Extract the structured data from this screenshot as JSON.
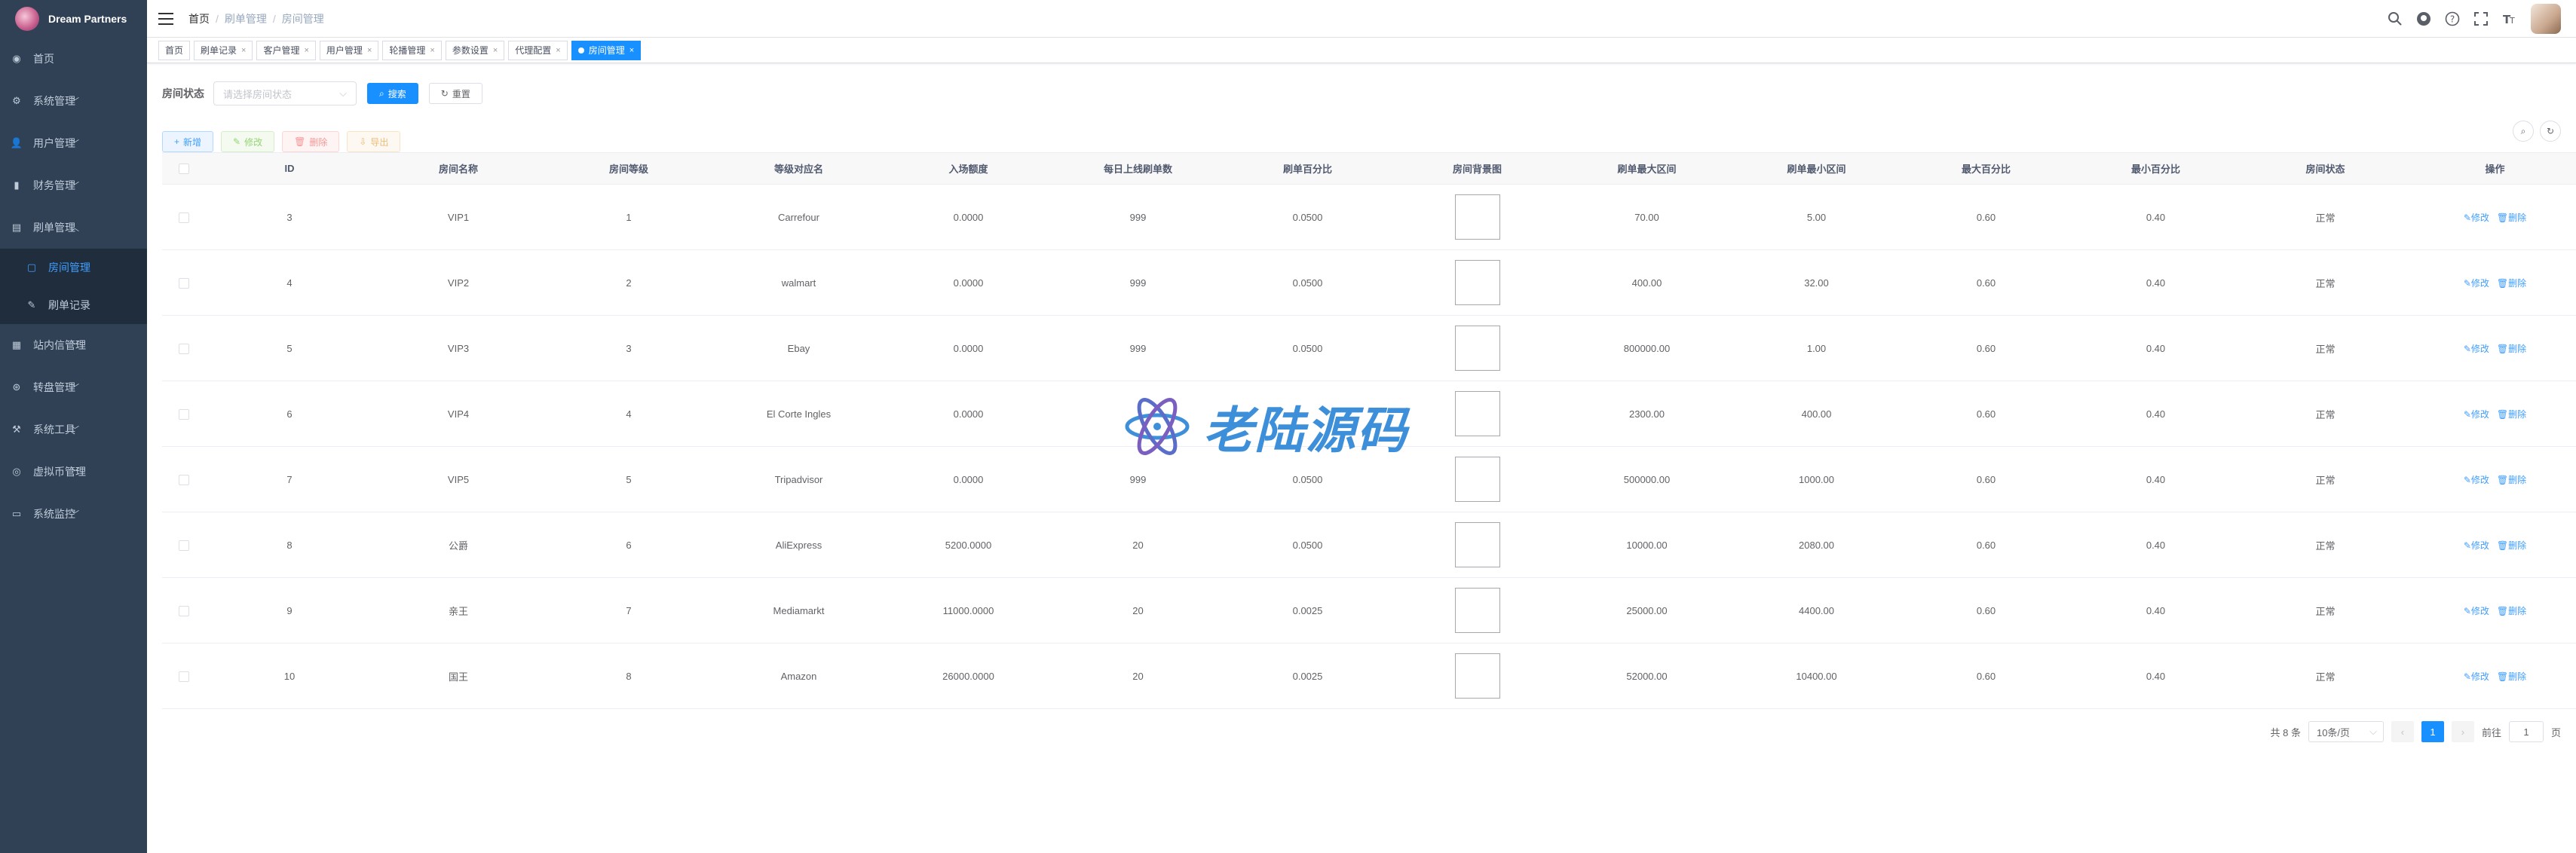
{
  "app": {
    "name": "Dream Partners"
  },
  "sidebar": {
    "items": [
      {
        "label": "首页",
        "icon": "dashboard-icon"
      },
      {
        "label": "系统管理",
        "icon": "gear-icon"
      },
      {
        "label": "用户管理",
        "icon": "users-icon"
      },
      {
        "label": "财务管理",
        "icon": "bar-chart-icon"
      },
      {
        "label": "刷单管理",
        "icon": "document-icon"
      },
      {
        "label": "站内信管理",
        "icon": "folder-icon"
      },
      {
        "label": "转盘管理",
        "icon": "wheel-icon"
      },
      {
        "label": "系统工具",
        "icon": "tool-icon"
      },
      {
        "label": "虚拟币管理",
        "icon": "coin-icon"
      },
      {
        "label": "系统监控",
        "icon": "monitor-icon"
      }
    ],
    "submenu": [
      {
        "label": "房间管理",
        "icon": "window-icon"
      },
      {
        "label": "刷单记录",
        "icon": "edit-icon"
      }
    ]
  },
  "breadcrumb": {
    "home": "首页",
    "parent": "刷单管理",
    "current": "房间管理"
  },
  "tags": {
    "items": [
      "首页",
      "刷单记录",
      "客户管理",
      "用户管理",
      "轮播管理",
      "参数设置",
      "代理配置",
      "房间管理"
    ]
  },
  "search": {
    "label": "房间状态",
    "placeholder": "请选择房间状态",
    "search_btn": "搜索",
    "reset_btn": "重置"
  },
  "toolbar": {
    "add": "新增",
    "edit": "修改",
    "delete": "删除",
    "export": "导出"
  },
  "table": {
    "headers": [
      "ID",
      "房间名称",
      "房间等级",
      "等级对应名",
      "入场额度",
      "每日上线刷单数",
      "刷单百分比",
      "房间背景图",
      "刷单最大区间",
      "刷单最小区间",
      "最大百分比",
      "最小百分比",
      "房间状态",
      "操作"
    ],
    "op_edit": "修改",
    "op_delete": "删除",
    "rows": [
      {
        "id": "3",
        "name": "VIP1",
        "level": "1",
        "level_name": "Carrefour",
        "entry": "0.0000",
        "daily": "999",
        "percent": "0.0500",
        "max_range": "70.00",
        "min_range": "5.00",
        "max_pct": "0.60",
        "min_pct": "0.40",
        "status": "正常"
      },
      {
        "id": "4",
        "name": "VIP2",
        "level": "2",
        "level_name": "walmart",
        "entry": "0.0000",
        "daily": "999",
        "percent": "0.0500",
        "max_range": "400.00",
        "min_range": "32.00",
        "max_pct": "0.60",
        "min_pct": "0.40",
        "status": "正常"
      },
      {
        "id": "5",
        "name": "VIP3",
        "level": "3",
        "level_name": "Ebay",
        "entry": "0.0000",
        "daily": "999",
        "percent": "0.0500",
        "max_range": "800000.00",
        "min_range": "1.00",
        "max_pct": "0.60",
        "min_pct": "0.40",
        "status": "正常"
      },
      {
        "id": "6",
        "name": "VIP4",
        "level": "4",
        "level_name": "El Corte Ingles",
        "entry": "0.0000",
        "daily": "",
        "percent": "",
        "max_range": "2300.00",
        "min_range": "400.00",
        "max_pct": "0.60",
        "min_pct": "0.40",
        "status": "正常"
      },
      {
        "id": "7",
        "name": "VIP5",
        "level": "5",
        "level_name": "Tripadvisor",
        "entry": "0.0000",
        "daily": "999",
        "percent": "0.0500",
        "max_range": "500000.00",
        "min_range": "1000.00",
        "max_pct": "0.60",
        "min_pct": "0.40",
        "status": "正常"
      },
      {
        "id": "8",
        "name": "公爵",
        "level": "6",
        "level_name": "AliExpress",
        "entry": "5200.0000",
        "daily": "20",
        "percent": "0.0500",
        "max_range": "10000.00",
        "min_range": "2080.00",
        "max_pct": "0.60",
        "min_pct": "0.40",
        "status": "正常"
      },
      {
        "id": "9",
        "name": "亲王",
        "level": "7",
        "level_name": "Mediamarkt",
        "entry": "11000.0000",
        "daily": "20",
        "percent": "0.0025",
        "max_range": "25000.00",
        "min_range": "4400.00",
        "max_pct": "0.60",
        "min_pct": "0.40",
        "status": "正常"
      },
      {
        "id": "10",
        "name": "国王",
        "level": "8",
        "level_name": "Amazon",
        "entry": "26000.0000",
        "daily": "20",
        "percent": "0.0025",
        "max_range": "52000.00",
        "min_range": "10400.00",
        "max_pct": "0.60",
        "min_pct": "0.40",
        "status": "正常"
      }
    ]
  },
  "pagination": {
    "total": "共 8 条",
    "page_size": "10条/页",
    "current": "1",
    "goto_label": "前往",
    "goto_value": "1",
    "page_suffix": "页"
  },
  "watermark": {
    "text": "老陆源码"
  },
  "colors": {
    "sidebar_bg": "#304156",
    "primary": "#1890ff",
    "active_menu": "#409eff"
  }
}
